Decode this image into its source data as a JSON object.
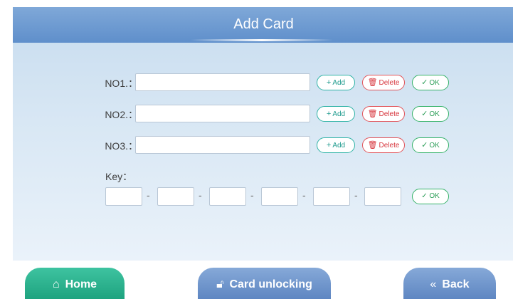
{
  "header": {
    "title": "Add Card"
  },
  "cards": [
    {
      "label": "NO1.：",
      "value": "",
      "add_label": "Add",
      "delete_label": "Delete",
      "ok_label": "OK"
    },
    {
      "label": "NO2.：",
      "value": "",
      "add_label": "Add",
      "delete_label": "Delete",
      "ok_label": "OK"
    },
    {
      "label": "NO3.：",
      "value": "",
      "add_label": "Add",
      "delete_label": "Delete",
      "ok_label": "OK"
    }
  ],
  "key": {
    "label": "Key：",
    "fields": [
      "",
      "",
      "",
      "",
      "",
      ""
    ],
    "separator": "-",
    "ok_label": "OK"
  },
  "footer": {
    "home_label": "Home",
    "card_unlocking_label": "Card unlocking",
    "back_label": "Back"
  },
  "icons": {
    "add": "plus-icon",
    "delete": "trash-icon",
    "ok": "check-icon",
    "home": "home-icon",
    "card_unlocking": "unlock-icon",
    "back": "double-chevron-left-icon"
  },
  "colors": {
    "title_bar": "#6b98d0",
    "add_accent": "#2fb3a6",
    "delete_accent": "#e2545a",
    "ok_accent": "#37b36a",
    "home_button": "#2bb08c",
    "nav_button": "#6f95cc"
  }
}
